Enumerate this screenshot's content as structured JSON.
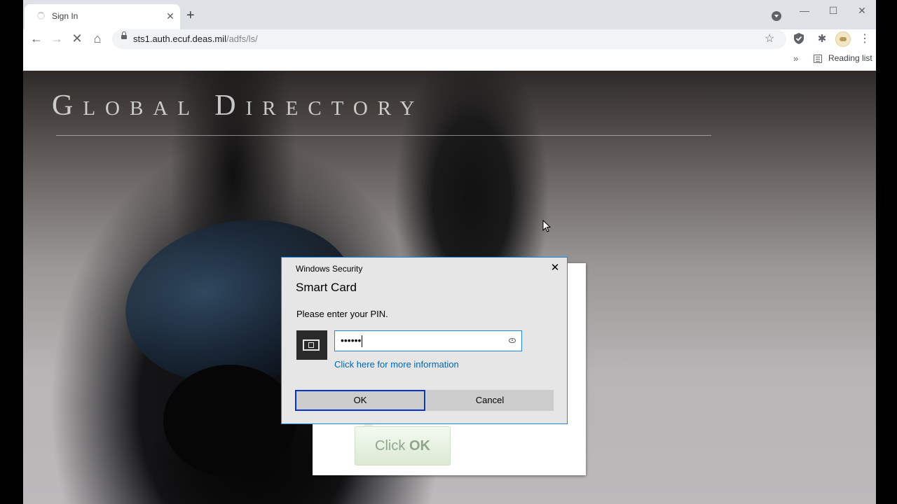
{
  "browser": {
    "tab": {
      "title": "Sign In"
    },
    "url": {
      "host": "sts1.auth.ecuf.deas.mil",
      "path": "/adfs/ls/"
    },
    "bookmarks": {
      "chevron": "»",
      "reading_list_label": "Reading list"
    },
    "icons": {
      "new_tab": "+",
      "tab_close": "✕",
      "back": "←",
      "forward": "→",
      "stop": "✕",
      "home": "⌂",
      "star": "☆",
      "extension": "✱",
      "menu": "⋮",
      "minimize": "—",
      "maximize": "☐",
      "close": "✕"
    }
  },
  "page": {
    "title_first_initial": "G",
    "title_first_rest": "LOBAL",
    "title_second_initial": "D",
    "title_second_rest": "IRECTORY",
    "hint_button_pre": "Click ",
    "hint_button_bold": "OK"
  },
  "dialog": {
    "window_title": "Windows Security",
    "heading": "Smart Card",
    "prompt": "Please enter your PIN.",
    "pin_masked": "••••••",
    "more_info_link": "Click here for more information",
    "ok_label": "OK",
    "cancel_label": "Cancel",
    "close_glyph": "✕"
  },
  "colors": {
    "accent_blue": "#1e88e5",
    "focus_border": "#0033cc",
    "link": "#0067b8",
    "dialog_bg": "#e6e6e6"
  }
}
